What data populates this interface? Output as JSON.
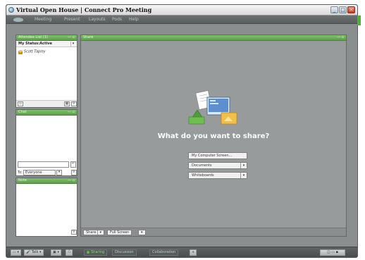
{
  "window": {
    "title": "Virtual Open House | Connect Pro Meeting",
    "min_label": "_",
    "max_label": "□",
    "close_label": "✕"
  },
  "menu": {
    "items": [
      "Meeting",
      "Present",
      "Layouts",
      "Pods",
      "Help"
    ]
  },
  "attendee_pod": {
    "title": "Attendee List (1)",
    "controls": "— ▫",
    "status": "My Status:Active",
    "status_arrow": "▾",
    "attendees": [
      {
        "name": "Scott Tapley",
        "role_icon": "host-icon"
      }
    ]
  },
  "chat_pod": {
    "title": "Chat",
    "controls": "— ▫",
    "to_label": "To:",
    "to_value": "Everyone",
    "send_icon": "↵"
  },
  "note_pod": {
    "title": "Note",
    "controls": "— ▫"
  },
  "share_pod": {
    "title": "Share",
    "controls": "— ▫",
    "question": "What do you want to share?",
    "options": [
      {
        "label": "My Computer Screen...",
        "has_arrow": false
      },
      {
        "label": "Documents",
        "has_arrow": true
      },
      {
        "label": "Whiteboards",
        "has_arrow": true
      }
    ],
    "footer": {
      "share_label": "Share",
      "fullscreen_label": "Full Screen"
    }
  },
  "bottom_bar": {
    "talk_label": "Talk",
    "layouts": [
      "Sharing",
      "Discussion",
      "Collaboration"
    ],
    "add_label": "+"
  }
}
